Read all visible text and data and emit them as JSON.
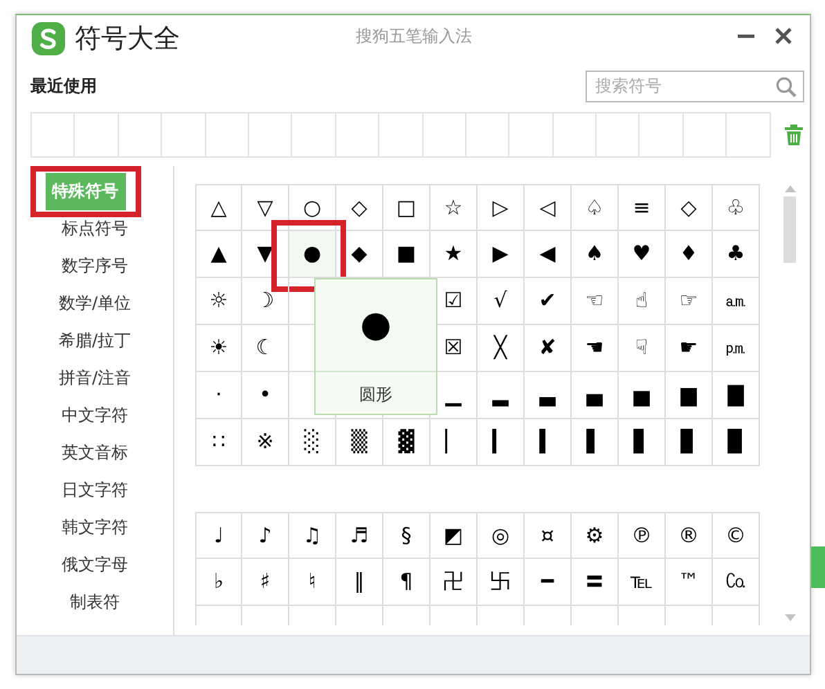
{
  "window": {
    "title": "符号大全",
    "app_name": "搜狗五笔输入法"
  },
  "recent": {
    "label": "最近使用"
  },
  "search": {
    "placeholder": "搜索符号"
  },
  "categories": [
    {
      "label": "特殊符号",
      "selected": true
    },
    {
      "label": "标点符号",
      "selected": false
    },
    {
      "label": "数字序号",
      "selected": false
    },
    {
      "label": "数学/单位",
      "selected": false
    },
    {
      "label": "希腊/拉丁",
      "selected": false
    },
    {
      "label": "拼音/注音",
      "selected": false
    },
    {
      "label": "中文字符",
      "selected": false
    },
    {
      "label": "英文音标",
      "selected": false
    },
    {
      "label": "日文字符",
      "selected": false
    },
    {
      "label": "韩文字符",
      "selected": false
    },
    {
      "label": "俄文字母",
      "selected": false
    },
    {
      "label": "制表符",
      "selected": false
    }
  ],
  "symbol_blocks": [
    {
      "rows": [
        [
          {
            "c": "△",
            "selected": false
          },
          {
            "c": "▽",
            "selected": false
          },
          {
            "c": "○",
            "selected": false
          },
          {
            "c": "◇",
            "selected": false
          },
          {
            "c": "□",
            "selected": false
          },
          {
            "c": "☆",
            "selected": false
          },
          {
            "c": "▷",
            "selected": false
          },
          {
            "c": "◁",
            "selected": false
          },
          {
            "c": "♤",
            "selected": false
          },
          {
            "c": "≡",
            "selected": false
          },
          {
            "c": "◇",
            "selected": false
          },
          {
            "c": "♧",
            "selected": false
          }
        ],
        [
          {
            "c": "▲",
            "selected": false
          },
          {
            "c": "▼",
            "selected": false
          },
          {
            "c": "●",
            "selected": true
          },
          {
            "c": "◆",
            "selected": false
          },
          {
            "c": "■",
            "selected": false
          },
          {
            "c": "★",
            "selected": false
          },
          {
            "c": "▶",
            "selected": false
          },
          {
            "c": "◀",
            "selected": false
          },
          {
            "c": "♠",
            "selected": false
          },
          {
            "c": "♥",
            "selected": false
          },
          {
            "c": "♦",
            "selected": false
          },
          {
            "c": "♣",
            "selected": false
          }
        ],
        [
          {
            "c": "☼",
            "selected": false
          },
          {
            "c": "☽",
            "selected": false
          },
          null,
          null,
          null,
          {
            "c": "☑",
            "selected": false
          },
          {
            "c": "√",
            "selected": false
          },
          {
            "c": "✔",
            "selected": false
          },
          {
            "c": "☜",
            "selected": false
          },
          {
            "c": "☝",
            "selected": false
          },
          {
            "c": "☞",
            "selected": false
          },
          {
            "c": "㏂",
            "selected": false
          }
        ],
        [
          {
            "c": "☀",
            "selected": false
          },
          {
            "c": "☾",
            "selected": false
          },
          null,
          null,
          null,
          {
            "c": "☒",
            "selected": false
          },
          {
            "c": "╳",
            "selected": false
          },
          {
            "c": "✘",
            "selected": false
          },
          {
            "c": "☚",
            "selected": false
          },
          {
            "c": "☟",
            "selected": false
          },
          {
            "c": "☛",
            "selected": false
          },
          {
            "c": "㏘",
            "selected": false
          }
        ],
        [
          {
            "c": "·",
            "selected": false
          },
          {
            "c": "•",
            "selected": false
          },
          null,
          null,
          null,
          {
            "c": "▁",
            "selected": false
          },
          {
            "c": "▂",
            "selected": false
          },
          {
            "c": "▃",
            "selected": false
          },
          {
            "c": "▄",
            "selected": false
          },
          {
            "c": "▅",
            "selected": false
          },
          {
            "c": "▆",
            "selected": false
          },
          {
            "c": "▇",
            "selected": false
          }
        ],
        [
          {
            "c": "∷",
            "selected": false
          },
          {
            "c": "※",
            "selected": false
          },
          {
            "c": "░",
            "selected": false
          },
          {
            "c": "▒",
            "selected": false
          },
          {
            "c": "▓",
            "selected": false
          },
          {
            "c": "▏",
            "selected": false
          },
          {
            "c": "▎",
            "selected": false
          },
          {
            "c": "▍",
            "selected": false
          },
          {
            "c": "▌",
            "selected": false
          },
          {
            "c": "▋",
            "selected": false
          },
          {
            "c": "▊",
            "selected": false
          },
          {
            "c": "▉",
            "selected": false
          }
        ]
      ]
    },
    {
      "rows": [
        [
          {
            "c": "♩",
            "selected": false
          },
          {
            "c": "♪",
            "selected": false
          },
          {
            "c": "♫",
            "selected": false
          },
          {
            "c": "♬",
            "selected": false
          },
          {
            "c": "§",
            "selected": false
          },
          {
            "c": "◩",
            "selected": false
          },
          {
            "c": "◎",
            "selected": false
          },
          {
            "c": "¤",
            "selected": false
          },
          {
            "c": "⚙",
            "selected": false
          },
          {
            "c": "℗",
            "selected": false
          },
          {
            "c": "®",
            "selected": false
          },
          {
            "c": "©",
            "selected": false
          }
        ],
        [
          {
            "c": "♭",
            "selected": false
          },
          {
            "c": "♯",
            "selected": false
          },
          {
            "c": "♮",
            "selected": false
          },
          {
            "c": "‖",
            "selected": false
          },
          {
            "c": "¶",
            "selected": false
          },
          {
            "c": "卍",
            "selected": false
          },
          {
            "c": "卐",
            "selected": false
          },
          {
            "c": "━",
            "selected": false
          },
          {
            "c": "〓",
            "selected": false
          },
          {
            "c": "℡",
            "selected": false
          },
          {
            "c": "™",
            "selected": false
          },
          {
            "c": "㏇",
            "selected": false
          }
        ]
      ]
    }
  ],
  "tooltip": {
    "symbol": "●",
    "name": "圆形"
  }
}
